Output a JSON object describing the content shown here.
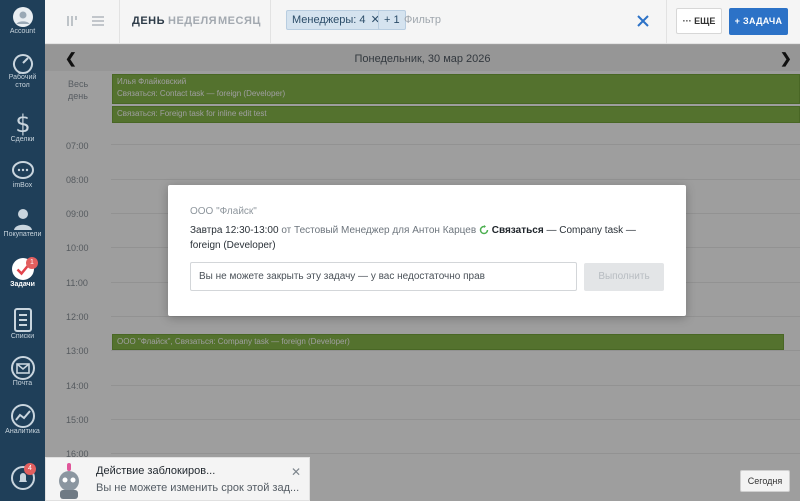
{
  "sidebar": {
    "items": [
      {
        "label": "Account",
        "icon": "account-icon"
      },
      {
        "label": "Рабочий",
        "label2": "стол",
        "icon": "desktop-icon"
      },
      {
        "label": "Сделки",
        "icon": "dollar-icon"
      },
      {
        "label": "imBox",
        "icon": "chat-icon"
      },
      {
        "label": "Покупатели",
        "icon": "customers-icon"
      },
      {
        "label": "Задачи",
        "icon": "tasks-icon",
        "badge": "1"
      },
      {
        "label": "Списки",
        "icon": "lists-icon"
      },
      {
        "label": "Почта",
        "icon": "mail-icon"
      },
      {
        "label": "Аналитика",
        "icon": "analytics-icon"
      },
      {
        "label": "",
        "icon": "notifications-icon",
        "badge": "4"
      }
    ]
  },
  "topbar": {
    "tabs": [
      "ДЕНЬ",
      "НЕДЕЛЯ",
      "МЕСЯЦ"
    ],
    "active_tab": "ДЕНЬ",
    "filter_chip": "Менеджеры: 4",
    "plus_chip": "+ 1",
    "filter_placeholder": "Фильтр",
    "more_label": "ЕЩЕ",
    "add_task_label": "+ ЗАДАЧА"
  },
  "datebar": {
    "date": "Понедельник, 30 мар 2026"
  },
  "calendar": {
    "allday_label_1": "Весь",
    "allday_label_2": "день",
    "hours": [
      "07:00",
      "08:00",
      "09:00",
      "10:00",
      "11:00",
      "12:00",
      "13:00",
      "14:00",
      "15:00",
      "16:00"
    ],
    "events": [
      {
        "line1": "Илья Флайковский",
        "line2": "Связаться: Contact task — foreign (Developer)"
      },
      {
        "line1": "Связаться: Foreign task for inline edit test"
      },
      {
        "line1": "ООО \"Флайск\", Связаться: Company task — foreign (Developer)"
      }
    ]
  },
  "modal": {
    "company": "ООО \"Флайск\"",
    "when": "Завтра 12:30-13:00",
    "from_to": "от Тестовый Менеджер для Антон Карцев",
    "action": "Связаться",
    "rest": "— Company task — foreign (Developer)",
    "input_placeholder": "Вы не можете закрыть эту задачу — у вас недостаточно прав",
    "button": "Выполнить"
  },
  "notification": {
    "title": "Действие заблокиров...",
    "text": "Вы не можете изменить срок этой зад..."
  },
  "today_button": "Сегодня",
  "colors": {
    "sidebar": "#1f3f59",
    "accent": "#2c72c7",
    "event": "#88b84b",
    "sync": "#4caf50"
  }
}
